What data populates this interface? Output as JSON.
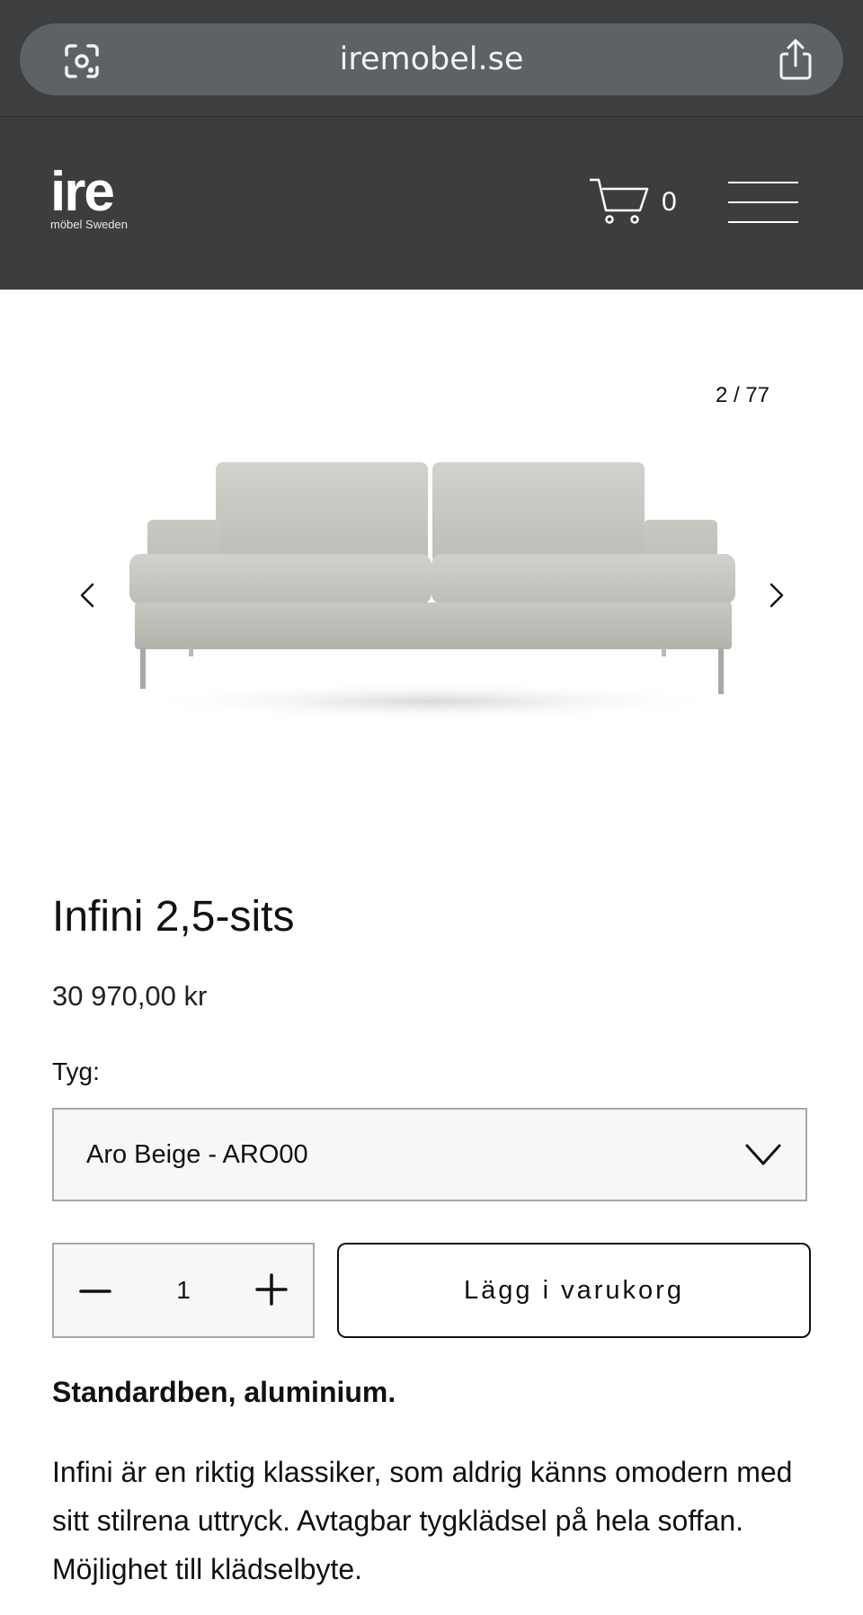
{
  "browser": {
    "url": "iremobel.se",
    "icons": {
      "left": "lens-camera-icon",
      "right": "share-icon"
    }
  },
  "header": {
    "logo_main": "ire",
    "logo_sub": "möbel Sweden",
    "cart_count": "0",
    "icons": {
      "cart": "cart-icon",
      "menu": "hamburger-menu-icon"
    },
    "background": "#3d3d3d"
  },
  "gallery": {
    "counter": "2 / 77",
    "icons": {
      "prev": "chevron-left-icon",
      "next": "chevron-right-icon"
    }
  },
  "product": {
    "title": "Infini 2,5-sits",
    "price": "30 970,00 kr",
    "fabric_label": "Tyg:",
    "fabric_selected": "Aro Beige - ARO00",
    "quantity": "1",
    "add_to_cart_label": "Lägg i varukorg",
    "legs_note": "Standardben, aluminium.",
    "description": "Infini är en riktig klassiker, som aldrig känns omodern med sitt stilrena uttryck. Avtagbar tygklädsel på hela soffan. Möjlighet till klädselbyte."
  }
}
